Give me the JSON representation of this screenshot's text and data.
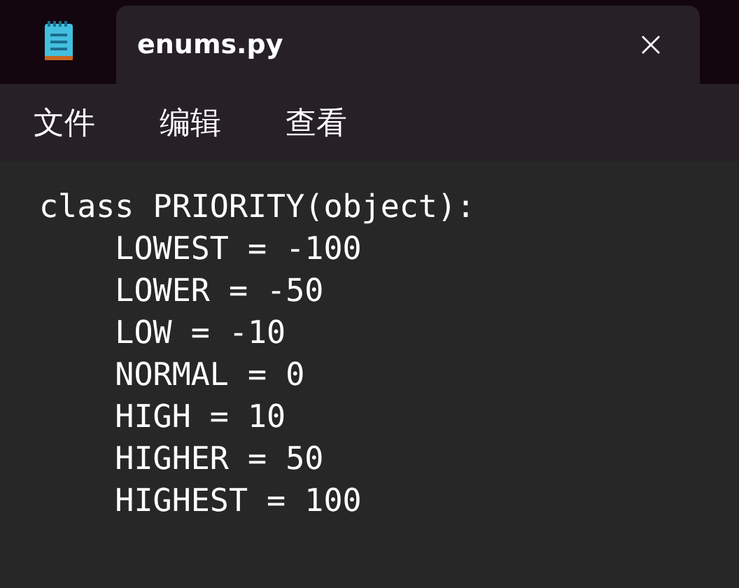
{
  "tabs": [
    {
      "title": "enums.py",
      "selected": true
    }
  ],
  "menu": [
    "文件",
    "编辑",
    "查看"
  ],
  "editor": {
    "lines": [
      "class PRIORITY(object):",
      "    LOWEST = -100",
      "    LOWER = -50",
      "    LOW = -10",
      "    NORMAL = 0",
      "    HIGH = 10",
      "    HIGHER = 50",
      "    HIGHEST = 100"
    ]
  }
}
